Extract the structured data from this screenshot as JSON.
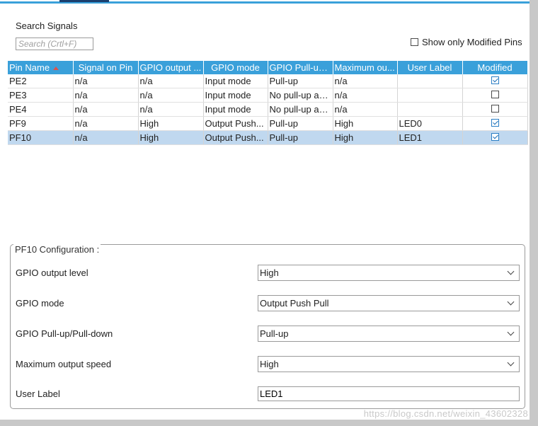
{
  "search": {
    "label": "Search Signals",
    "placeholder": "Search (Crtl+F)",
    "show_modified_label": "Show only Modified Pins",
    "show_modified_checked": false
  },
  "table": {
    "headers": [
      "Pin Name",
      "Signal on Pin",
      "GPIO output ...",
      "GPIO mode",
      "GPIO Pull-up...",
      "Maximum ou...",
      "User Label",
      "Modified"
    ],
    "rows": [
      {
        "pin": "PE2",
        "signal": "n/a",
        "output": "n/a",
        "mode": "Input mode",
        "pull": "Pull-up",
        "speed": "n/a",
        "label": "",
        "modified": true
      },
      {
        "pin": "PE3",
        "signal": "n/a",
        "output": "n/a",
        "mode": "Input mode",
        "pull": "No pull-up an...",
        "speed": "n/a",
        "label": "",
        "modified": false
      },
      {
        "pin": "PE4",
        "signal": "n/a",
        "output": "n/a",
        "mode": "Input mode",
        "pull": "No pull-up an...",
        "speed": "n/a",
        "label": "",
        "modified": false
      },
      {
        "pin": "PF9",
        "signal": "n/a",
        "output": "High",
        "mode": "Output Push...",
        "pull": "Pull-up",
        "speed": "High",
        "label": "LED0",
        "modified": true
      },
      {
        "pin": "PF10",
        "signal": "n/a",
        "output": "High",
        "mode": "Output Push...",
        "pull": "Pull-up",
        "speed": "High",
        "label": "LED1",
        "modified": true
      }
    ],
    "selected_index": 4
  },
  "config": {
    "title": "PF10 Configuration :",
    "fields": [
      {
        "label": "GPIO output level",
        "value": "High"
      },
      {
        "label": "GPIO mode",
        "value": "Output Push Pull"
      },
      {
        "label": "GPIO Pull-up/Pull-down",
        "value": "Pull-up"
      },
      {
        "label": "Maximum output speed",
        "value": "High"
      }
    ],
    "user_label": {
      "label": "User Label",
      "value": "LED1"
    }
  },
  "watermark": "https://blog.csdn.net/weixin_43602328",
  "colors": {
    "header": "#3aa0da",
    "selected_row": "#c0d8ef",
    "checkbox_check": "#1c6fb8"
  },
  "icons": {
    "sort": "sort-ascending-icon",
    "dropdown": "chevron-down-icon",
    "checkbox": "checkbox-icon"
  }
}
